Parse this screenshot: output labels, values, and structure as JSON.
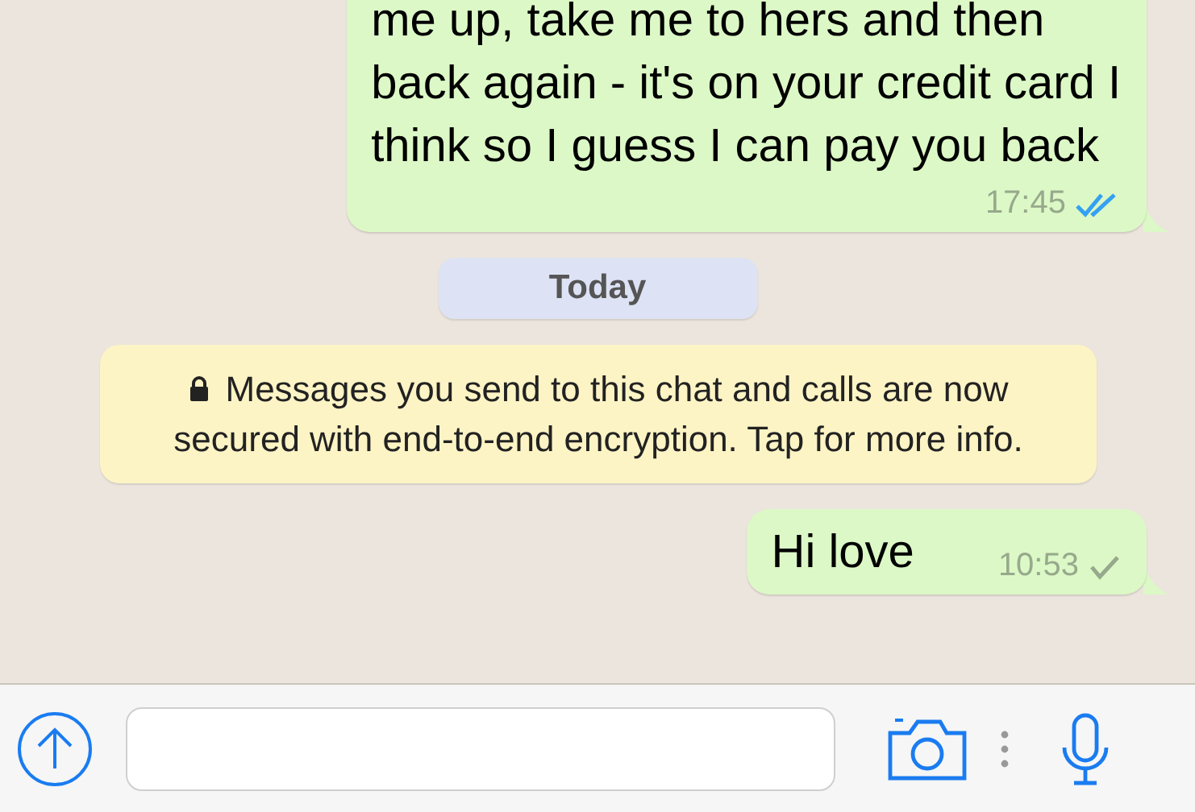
{
  "messages": [
    {
      "kind": "outgoing",
      "lines": [
        "me up, take me to hers and then",
        "back again - it's on your credit card I",
        "think so I guess I can pay you back"
      ],
      "time": "17:45",
      "read": true
    },
    {
      "kind": "date",
      "text": "Today"
    },
    {
      "kind": "notice",
      "text": "Messages you send to this chat and calls are now secured with end-to-end encryption. Tap for more info."
    },
    {
      "kind": "outgoing",
      "lines": [
        "Hi love"
      ],
      "time": "10:53",
      "read": false
    }
  ]
}
